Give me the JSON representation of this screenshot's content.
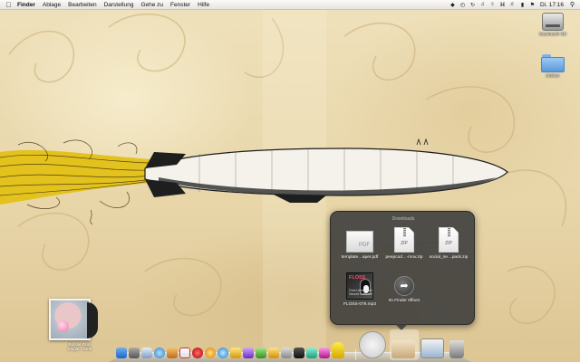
{
  "menubar": {
    "app_name": "Finder",
    "menus": [
      "Ablage",
      "Bearbeiten",
      "Darstellung",
      "Gehe zu",
      "Fenster",
      "Hilfe"
    ],
    "clock": "Di. 17:16",
    "status_icons": [
      "dropbox-icon",
      "time-machine-icon",
      "sync-icon",
      "music-icon",
      "bluetooth-icon",
      "wifi-icon",
      "volume-icon",
      "battery-icon",
      "flag-icon"
    ]
  },
  "desktop": {
    "icons": [
      {
        "name": "hard-drive",
        "label": "Macintosh HD"
      },
      {
        "name": "folder",
        "label": "Ordner"
      }
    ]
  },
  "album": {
    "caption_line1": "Bubble Gum",
    "caption_line2": "Single / 2009"
  },
  "stack": {
    "title": "Downloads",
    "items": [
      {
        "name": "pdf-file",
        "label": "template…aper.pdf",
        "ext": "PDF"
      },
      {
        "name": "zip-file-1",
        "label": "peepcod…-mov.zip",
        "ext": "ZIP"
      },
      {
        "name": "zip-file-2",
        "label": "social_ne…pack.zip",
        "ext": "ZIP"
      },
      {
        "name": "mp3-file",
        "label": "FLOSS-079.mp3",
        "cover_text": "FLOSS",
        "cover_tag": "Free Libre Open Source Software"
      },
      {
        "name": "open-in-finder",
        "label": "Im Finder öffnen"
      }
    ]
  },
  "colors": {
    "menubar": "#ececec",
    "stack_bg": "#3a3a3a",
    "wallpaper": "#e8d6a9",
    "rope": "#e3c21d"
  }
}
